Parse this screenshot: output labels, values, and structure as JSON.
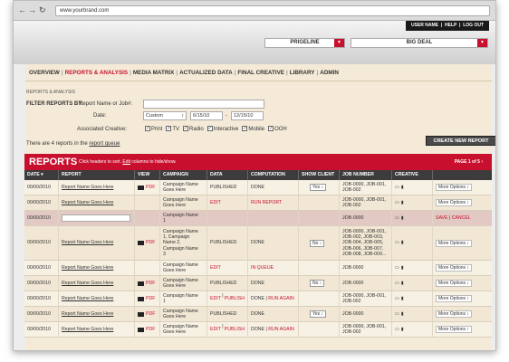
{
  "browser": {
    "url": "www.yourbrand.com"
  },
  "top_links": {
    "user": "USER NAME",
    "help": "HELP",
    "logout": "LOG OUT"
  },
  "selects": {
    "brand": "PRIGELINE",
    "deal": "BIG DEAL"
  },
  "tabs": [
    {
      "label": "OVERVIEW",
      "active": false
    },
    {
      "label": "REPORTS & ANALYSIS",
      "active": true
    },
    {
      "label": "MEDIA MATRIX",
      "active": false
    },
    {
      "label": "ACTUALIZED DATA",
      "active": false
    },
    {
      "label": "FINAL CREATIVE",
      "active": false
    },
    {
      "label": "LIBRARY",
      "active": false
    },
    {
      "label": "ADMIN",
      "active": false
    }
  ],
  "breadcrumb": "REPORTS & ANALYSIS",
  "filter": {
    "label": "FILTER REPORTS BY:",
    "name_label": "Report Name or Job#:",
    "date_label": "Date:",
    "date_mode": "Custom",
    "date_from": "6/15/10",
    "date_sep": "-",
    "date_to": "12/15/10",
    "creative_label": "Associated Creative:",
    "creatives": [
      "Print",
      "TV",
      "Radio",
      "Interactive",
      "Mobile",
      "OOH"
    ]
  },
  "queue": {
    "prefix": "There are 4 reports in the",
    "link": "report queue"
  },
  "create_button": "CREATE NEW REPORT",
  "reports": {
    "title": "REPORTS",
    "sub_a": "Click headers to sort.",
    "sub_link": "Edit",
    "sub_b": "columns to hide/show.",
    "page": "PAGE 1 of 5 ›"
  },
  "columns": [
    "DATE ▾",
    "REPORT",
    "VIEW",
    "CAMPAIGN",
    "DATA",
    "COMPUTATION",
    "SHOW CLIENT",
    "JOB NUMBER",
    "CREATIVE"
  ],
  "rows": [
    {
      "date": "00/00/2010",
      "report": "Report Name Goes Here",
      "view": "PDF",
      "campaign": "Campaign Name\nGoes Here",
      "data": "PUBLISHED",
      "comp": "DONE",
      "show": "Yes ↕",
      "job": "JOB-0000, JOB-001,\nJOB-002",
      "options": "More Options ↕"
    },
    {
      "date": "00/00/2010",
      "report": "Report Name Goes Here",
      "view": "",
      "campaign": "Campaign Name\nGoes Here",
      "data": "EDIT",
      "comp": "RUN REPORT",
      "show": "",
      "job": "JOB-0000, JOB-001,\nJOB-002",
      "options": "More Options ↕"
    },
    {
      "date": "00/00/2010",
      "report": "",
      "view": "",
      "campaign": "Campaign Name\n1",
      "data": "",
      "comp": "",
      "show": "",
      "job": "JOB-0000",
      "options": "",
      "save": "SAVE",
      "cancel": "CANCEL"
    },
    {
      "date": "00/00/2010",
      "report": "Report Name Goes Here",
      "view": "PDF",
      "campaign": "Campaign Name\n1, Campaign\nName 2,\nCampaign Name\n3",
      "data": "PUBLISHED",
      "comp": "DONE",
      "show": "No ↕",
      "job": "JOB-0000, JOB-001,\nJOB-002, JOB-003,\nJOB-004, JOB-005,\nJOB-006, JOB-007,\nJOB-008, JOB-009...",
      "options": "More Options ↕"
    },
    {
      "date": "00/00/2010",
      "report": "Report Name Goes Here",
      "view": "",
      "campaign": "Campaign Name\nGoes Here",
      "data": "EDIT",
      "comp": "IN QUEUE",
      "show": "",
      "job": "JOB-0000",
      "options": "More Options ↕"
    },
    {
      "date": "00/00/2010",
      "report": "Report Name Goes Here",
      "view": "PDF",
      "campaign": "Campaign Name\nGoes Here",
      "data": "PUBLISHED",
      "comp": "DONE",
      "show": "No ↕",
      "job": "JOB-0000",
      "options": "More Options ↕"
    },
    {
      "date": "00/00/2010",
      "report": "Report Name Goes Here",
      "view": "PDF",
      "campaign": "Campaign Name\n1",
      "data_a": "EDIT",
      "data_b": "PUBLISH",
      "comp_a": "DONE",
      "comp_b": "RUN AGAIN",
      "show": "",
      "job": "JOB-0000, JOB-001,\nJOB-002",
      "options": "More Options ↕"
    },
    {
      "date": "00/00/2010",
      "report": "Report Name Goes Here",
      "view": "PDF",
      "campaign": "Campaign Name\nGoes Here",
      "data": "PUBLISHED",
      "comp": "DONE",
      "show": "Yes ↕",
      "job": "JOB-0000",
      "options": "More Options ↕"
    },
    {
      "date": "00/00/2010",
      "report": "Report Name Goes Here",
      "view": "PDF",
      "campaign": "Campaign Name\nGoes Here",
      "data_a": "EDIT",
      "data_b": "PUBLISH",
      "comp_a": "DONE",
      "comp_b": "RUN AGAIN",
      "show": "",
      "job": "JOB-0000, JOB-001,\nJOB-002",
      "options": "More Options ↕"
    }
  ],
  "colors": {
    "accent": "#c8102e",
    "header_dark": "#3c3c3c",
    "panel": "#f4ead7"
  }
}
